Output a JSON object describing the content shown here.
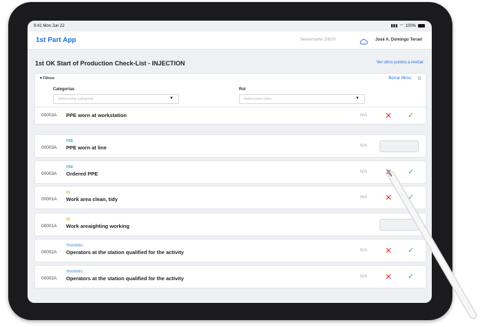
{
  "status": {
    "time": "9:41  Mon Jun 22",
    "battery": "100%"
  },
  "app": {
    "title": "1st Part App",
    "server": "Servername  2/9/20",
    "user": "José A. Domingo Teruel"
  },
  "page": {
    "title": "1st OK Start of Production Check-List - INJECTION",
    "more_link": "Ver otros puntos a revisar"
  },
  "filters": {
    "toggle": "Filtros",
    "clear": "Borrar filtros",
    "category_label": "Categorias",
    "category_placeholder": "Seleccione categoria",
    "role_label": "Rol",
    "role_placeholder": "Seleccione roles"
  },
  "colors": {
    "accent": "#1e6fd9",
    "hse": "#2ab7c6",
    "five_s": "#d6b84a",
    "training": "#7aa8e8",
    "reject": "#e53935",
    "approve": "#2fb655"
  },
  "rows": [
    {
      "code": "00003A",
      "tag": "",
      "text": "PPE worn at workstation",
      "na": "N/A",
      "state": "buttons"
    },
    {
      "code": "00003A",
      "tag": "HSE",
      "text": "PPE worn at line",
      "na": "N/A",
      "state": "box"
    },
    {
      "code": "00003A",
      "tag": "HSE",
      "text": "Ordered PPE",
      "na": "N/A",
      "state": "buttons"
    },
    {
      "code": "00001A",
      "tag": "5S",
      "text": "Work area clean, tidy",
      "na": "N/A",
      "state": "buttons"
    },
    {
      "code": "00001A",
      "tag": "5S",
      "text": "Work areaighting working",
      "na": "",
      "state": "box"
    },
    {
      "code": "00002A",
      "tag": "TRAINING",
      "text": "Operators at the station qualified for the activity",
      "na": "N/A",
      "state": "buttons"
    },
    {
      "code": "00002A",
      "tag": "TRAINING",
      "text": "Operators at the station qualified for the activity",
      "na": "N/A",
      "state": "buttons"
    }
  ]
}
